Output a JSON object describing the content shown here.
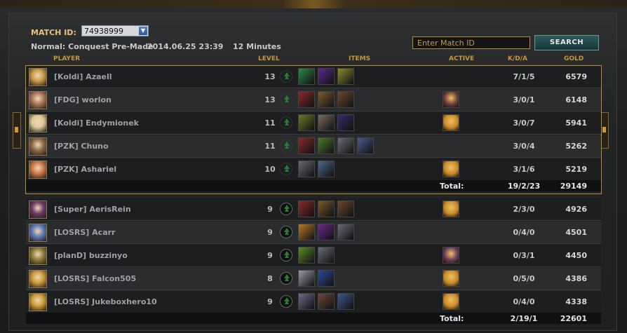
{
  "match": {
    "id_label": "MATCH ID:",
    "id_value": "74938999",
    "mode": "Normal: Conquest Pre-Made",
    "date": "2014.06.25 23:39",
    "duration": "12 Minutes"
  },
  "search": {
    "placeholder": "Enter Match ID",
    "button_label": "SEARCH"
  },
  "columns": {
    "player": "PLAYER",
    "level": "LEVEL",
    "items": "ITEMS",
    "active": "ACTIVE",
    "kda": "K/D/A",
    "gold": "GOLD"
  },
  "colors": {
    "accent": "#b88a2e",
    "header": "#c99733"
  },
  "team1": {
    "players": [
      {
        "name": "[Koldi] Azaell",
        "level": "13",
        "kda": "7/1/5",
        "gold": "6579",
        "avatar_color": "#c79a4a",
        "items": [
          "#2f8a4a",
          "#5a2a8a",
          "#8a8a2a"
        ],
        "active": null
      },
      {
        "name": "[FDG] worlon",
        "level": "13",
        "kda": "3/0/1",
        "gold": "6148",
        "avatar_color": "#a8755a",
        "items": [
          "#8a2a2a",
          "#7a5a2a",
          "#6a4a2a"
        ],
        "active": "#6a3a3a"
      },
      {
        "name": "[Koldi] Endymionek",
        "level": "11",
        "kda": "3/0/7",
        "gold": "5941",
        "avatar_color": "#d8c89a",
        "items": [
          "#6a7a2a",
          "#7a6a5a",
          "#3a2a6a"
        ],
        "active": "#c78a2a"
      },
      {
        "name": "[PZK] Chuno",
        "level": "11",
        "kda": "3/0/4",
        "gold": "5262",
        "avatar_color": "#8a6a4a",
        "items": [
          "#8a2a2a",
          "#4a7a2a",
          "#6a6a7a",
          "#4a5a8a"
        ],
        "active": null
      },
      {
        "name": "[PZK] Ashariel",
        "level": "10",
        "kda": "3/1/6",
        "gold": "5219",
        "avatar_color": "#c8784a",
        "items": [
          "#6a6a7a",
          "#4a6a8a"
        ],
        "active": "#c78a2a"
      }
    ],
    "total_label": "Total:",
    "total_kda": "19/2/23",
    "total_gold": "29149"
  },
  "team2": {
    "players": [
      {
        "name": "[Super] AerisRein",
        "level": "9",
        "kda": "2/3/0",
        "gold": "4926",
        "avatar_color": "#6a3a6a",
        "items": [
          "#8a2a2a",
          "#7a5a2a",
          "#6a4a2a"
        ],
        "active": "#c78a2a"
      },
      {
        "name": "[LOSRS] Acarr",
        "level": "9",
        "kda": "0/4/0",
        "gold": "4501",
        "avatar_color": "#5a7ab8",
        "items": [
          "#b8782a",
          "#6a2a8a",
          "#6a6a7a"
        ],
        "active": null
      },
      {
        "name": "[planD] buzzinyo",
        "level": "9",
        "kda": "0/3/1",
        "gold": "4450",
        "avatar_color": "#8a7a3a",
        "items": [
          "#5a8a2a",
          "#6a6a7a"
        ],
        "active": "#6a3a5a"
      },
      {
        "name": "[LOSRS] Falcon505",
        "level": "8",
        "kda": "0/5/0",
        "gold": "4386",
        "avatar_color": "#c89a3a",
        "items": [
          "#9a9aaa",
          "#2a4a9a"
        ],
        "active": "#c78a2a"
      },
      {
        "name": "[LOSRS] Jukeboxhero10",
        "level": "9",
        "kda": "0/4/0",
        "gold": "4338",
        "avatar_color": "#c89a3a",
        "items": [
          "#6a6a8a",
          "#6a4a3a",
          "#3a5a8a"
        ],
        "active": "#c78a2a"
      }
    ],
    "total_label": "Total:",
    "total_kda": "2/19/1",
    "total_gold": "22601"
  }
}
